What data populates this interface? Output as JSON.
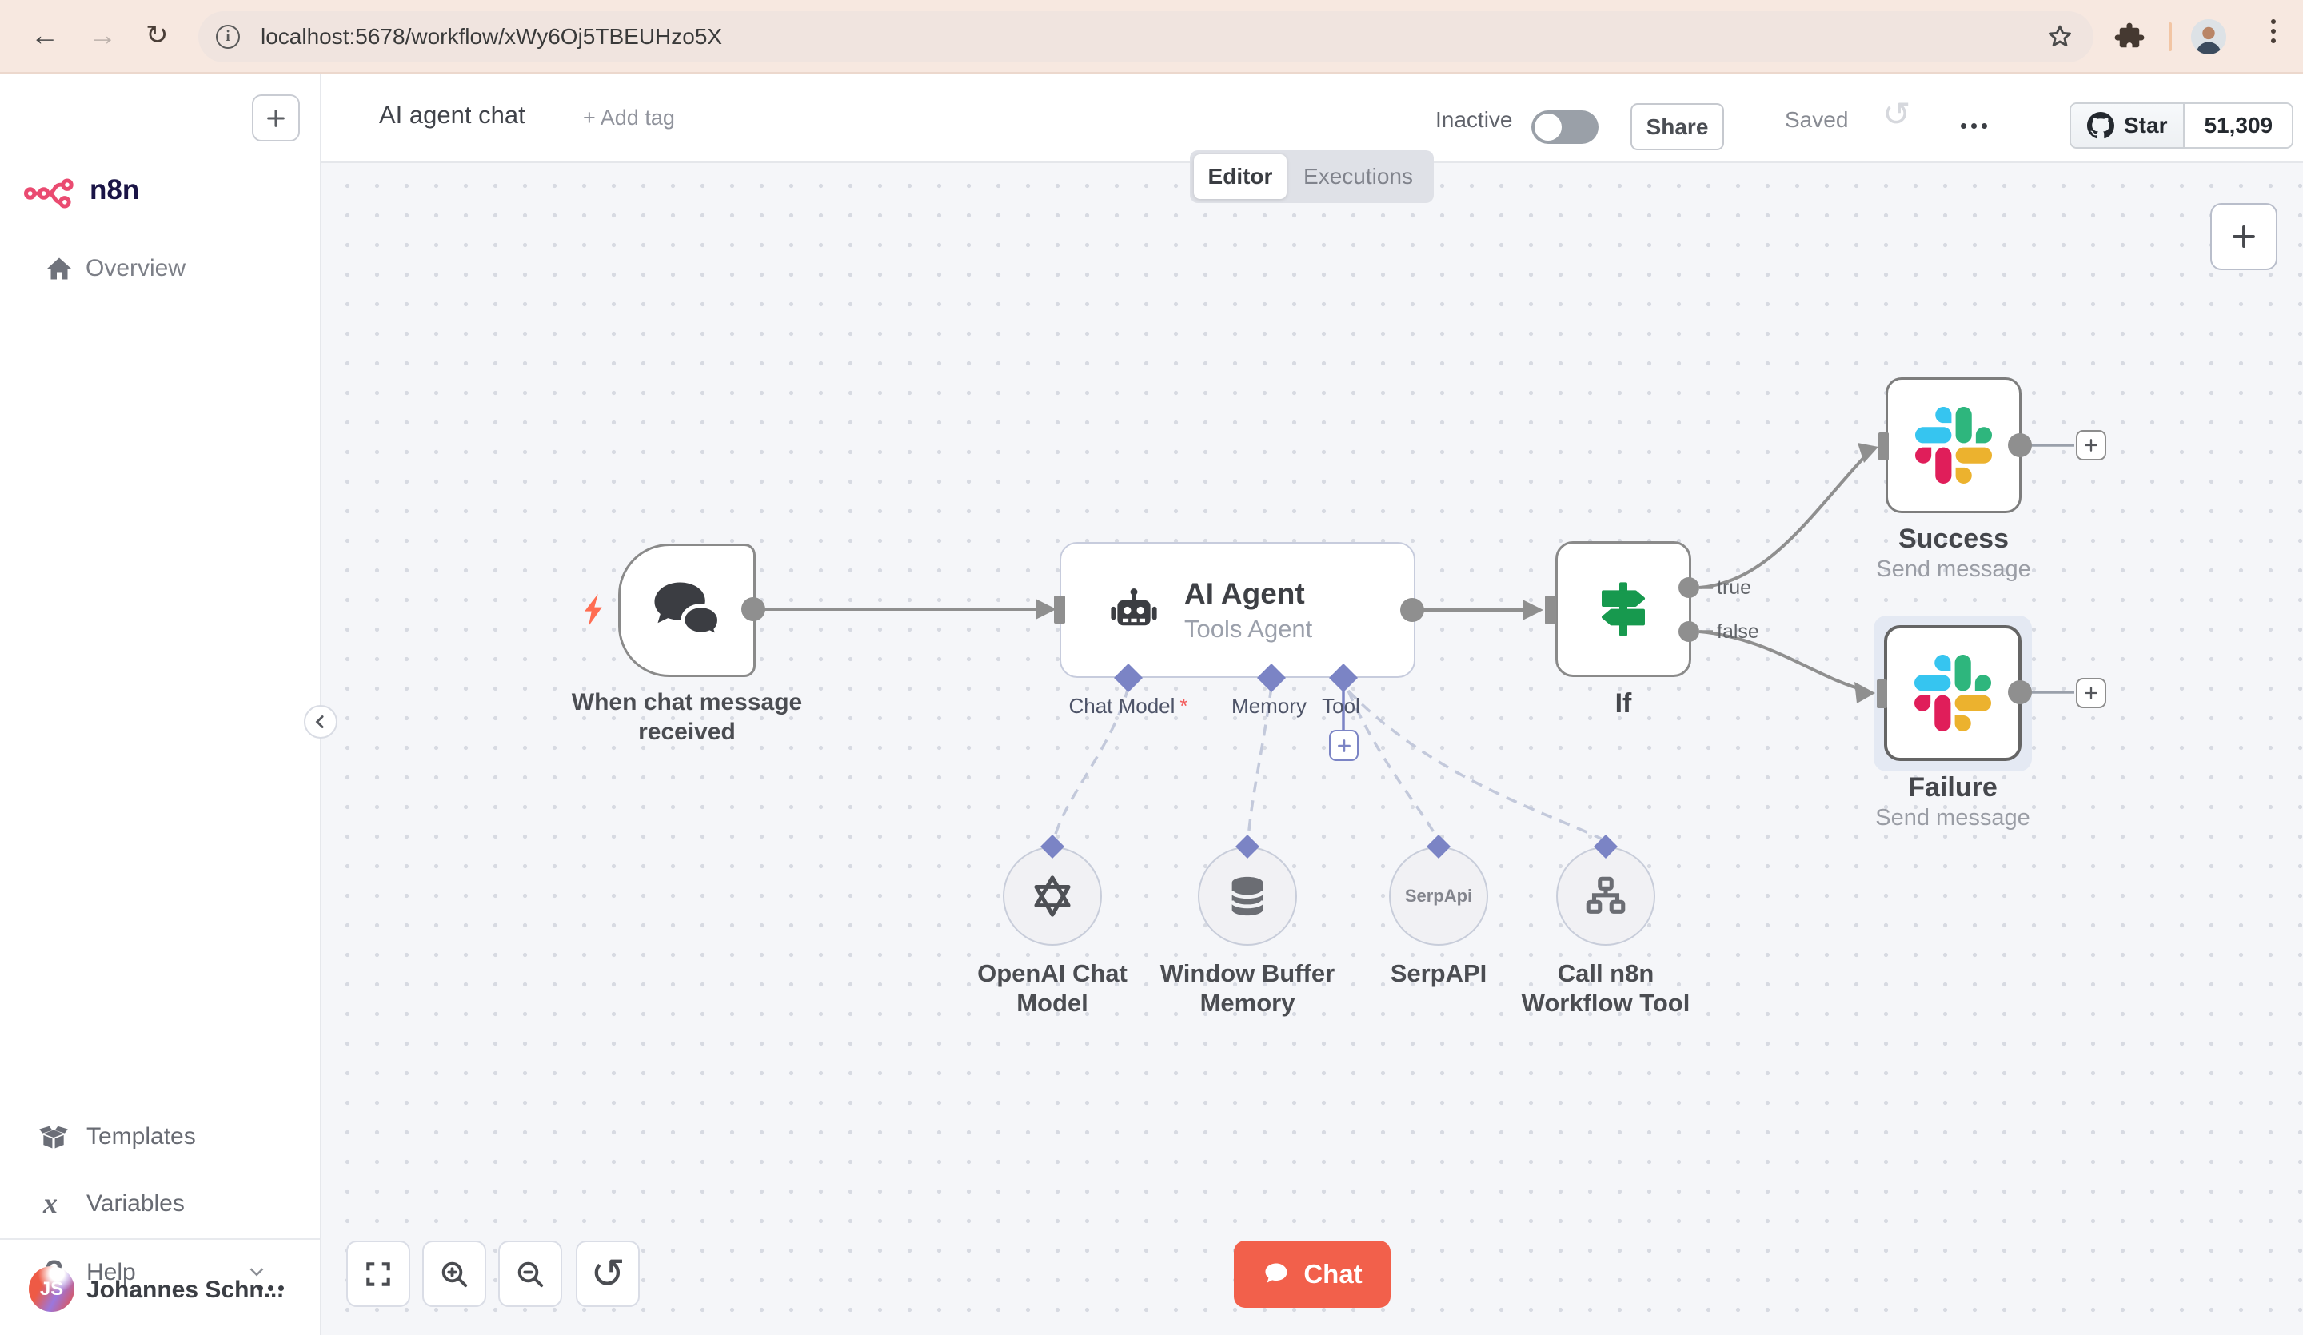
{
  "browser": {
    "url": "localhost:5678/workflow/xWy6Oj5TBEUHzo5X"
  },
  "sidebar": {
    "brand": "n8n",
    "overview": "Overview",
    "templates": "Templates",
    "variables": "Variables",
    "help": "Help",
    "user_name": "Johannes Schn...",
    "user_initials": "JS"
  },
  "header": {
    "title": "AI agent chat",
    "add_tag": "+ Add tag",
    "activation": "Inactive",
    "share": "Share",
    "saved": "Saved",
    "github_star": "Star",
    "github_count": "51,309"
  },
  "tabs": {
    "editor": "Editor",
    "executions": "Executions"
  },
  "workflow": {
    "trigger": {
      "label": "When chat message received"
    },
    "agent": {
      "title": "AI Agent",
      "subtitle": "Tools Agent"
    },
    "agent_ports": [
      {
        "label": "Chat Model",
        "required": "*"
      },
      {
        "label": "Memory",
        "required": ""
      },
      {
        "label": "Tool",
        "required": ""
      }
    ],
    "if": {
      "label": "If",
      "true": "true",
      "false": "false"
    },
    "success": {
      "title": "Success",
      "subtitle": "Send message"
    },
    "failure": {
      "title": "Failure",
      "subtitle": "Send message"
    },
    "openai": {
      "label": "OpenAI Chat Model"
    },
    "memory": {
      "label": "Window Buffer Memory"
    },
    "serpapi": {
      "label": "SerpAPI",
      "badge": "SerpApi"
    },
    "call_workflow": {
      "label": "Call n8n Workflow Tool"
    }
  },
  "controls": {
    "chat_button": "Chat"
  },
  "colors": {
    "brand_pink": "#EA4B71",
    "chat_orange": "#F2604B",
    "bolt_coral": "#FF6D52",
    "port_indigo": "#7B84C5",
    "if_green": "#17994E",
    "slack_blue": "#36C5F0",
    "slack_green": "#2EB67D",
    "slack_red": "#E01E5A",
    "slack_yellow": "#ECB22E"
  }
}
